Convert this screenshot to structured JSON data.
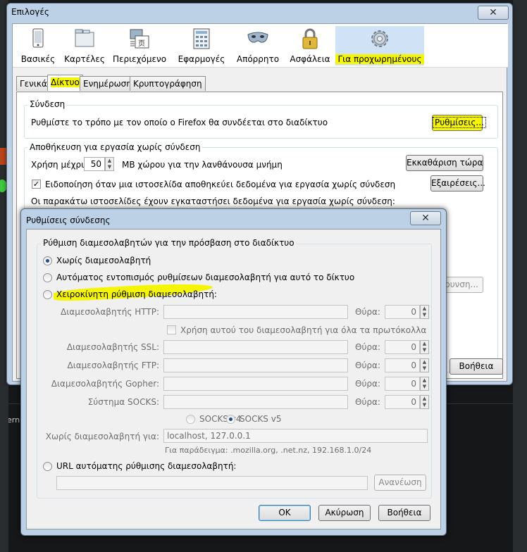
{
  "background": {
    "left_texts": [
      "stern"
    ]
  },
  "options": {
    "title": "Επιλογές",
    "close_glyph": "✕",
    "toolbar": [
      {
        "label": "Βασικές",
        "icon": "general-icon"
      },
      {
        "label": "Καρτέλες",
        "icon": "tabs-icon"
      },
      {
        "label": "Περιεχόμενο",
        "icon": "content-icon"
      },
      {
        "label": "Εφαρμογές",
        "icon": "applications-icon"
      },
      {
        "label": "Απόρρητο",
        "icon": "privacy-mask-icon"
      },
      {
        "label": "Ασφάλεια",
        "icon": "security-lock-icon"
      },
      {
        "label": "Για προχωρημένους",
        "icon": "advanced-gear-icon",
        "active": true
      }
    ],
    "tabs": [
      {
        "label": "Γενικά"
      },
      {
        "label": "Δίκτυο",
        "active": true
      },
      {
        "label": "Ενημέρωση"
      },
      {
        "label": "Κρυπτογράφηση"
      }
    ],
    "connection": {
      "group_title": "Σύνδεση",
      "description": "Ρυθμίστε το τρόπο με τον οποίο ο Firefox θα συνδέεται στο διαδίκτυο",
      "settings_button": "Ρυθμίσεις..."
    },
    "offline": {
      "group_title": "Αποθήκευση για εργασία χωρίς σύνδεση",
      "use_up_to": "Χρήση μέχρι",
      "cache_value": "50",
      "cache_unit": "MB χώρου για την λανθάνουσα μνήμη",
      "clear_now_button": "Εκκαθάριση τώρα",
      "notify_label": "Ειδοποίηση όταν μια ιστοσελίδα αποθηκεύει δεδομένα για εργασία χωρίς σύνδεση",
      "notify_checked": true,
      "exceptions_button": "Εξαιρέσεις...",
      "sites_label": "Οι παρακάτω ιστοσελίδες έχουν εγκαταστήσει δεδομένα για εργασία χωρίς σύνδεση:",
      "remove_button_partial": "κρυνση...",
      "help_button": "Βοήθεια"
    }
  },
  "connection_dialog": {
    "title": "Ρυθμίσεις σύνδεσης",
    "close_glyph": "✕",
    "group_title": "Ρύθμιση διαμεσολαβητών για την πρόσβαση στο διαδίκτυο",
    "options": [
      {
        "label": "Χωρίς διαμεσολαβητή",
        "selected": true
      },
      {
        "label": "Αυτόματος εντοπισμός ρυθμίσεων διαμεσολαβητή για αυτό το δίκτυο",
        "selected": false
      },
      {
        "label": "Χειροκίνητη ρύθμιση διαμεσολαβητή:",
        "selected": false
      }
    ],
    "port_label": "Θύρα:",
    "proxies": [
      {
        "label": "Διαμεσολαβητής HTTP:",
        "host": "",
        "port": "0"
      },
      {
        "label": "Διαμεσολαβητής SSL:",
        "host": "",
        "port": "0"
      },
      {
        "label": "Διαμεσολαβητής FTP:",
        "host": "",
        "port": "0"
      },
      {
        "label": "Διαμεσολαβητής Gopher:",
        "host": "",
        "port": "0"
      },
      {
        "label": "Σύστημα SOCKS:",
        "host": "",
        "port": "0"
      }
    ],
    "use_for_all": "Χρήση αυτού του διαμεσολαβητή για όλα τα πρωτόκολλα",
    "socks_v4": "SOCKS v4",
    "socks_v5": "SOCKS v5",
    "no_proxy_label": "Χωρίς διαμεσολαβητή για:",
    "no_proxy_value": "localhost, 127.0.0.1",
    "example": "Για παράδειγμα: .mozilla.org, .net.nz, 192.168.1.0/24",
    "auto_url_label": "URL αυτόματης ρύθμισης διαμεσολαβητή:",
    "auto_url_value": "",
    "reload_button": "Ανανέωση",
    "ok_button": "OK",
    "cancel_button": "Ακύρωση",
    "help_button": "Βοήθεια"
  },
  "colors": {
    "highlight": "#f5f500",
    "window_frame": "#bcd0e6",
    "dialog_face": "#f0f0f0"
  }
}
